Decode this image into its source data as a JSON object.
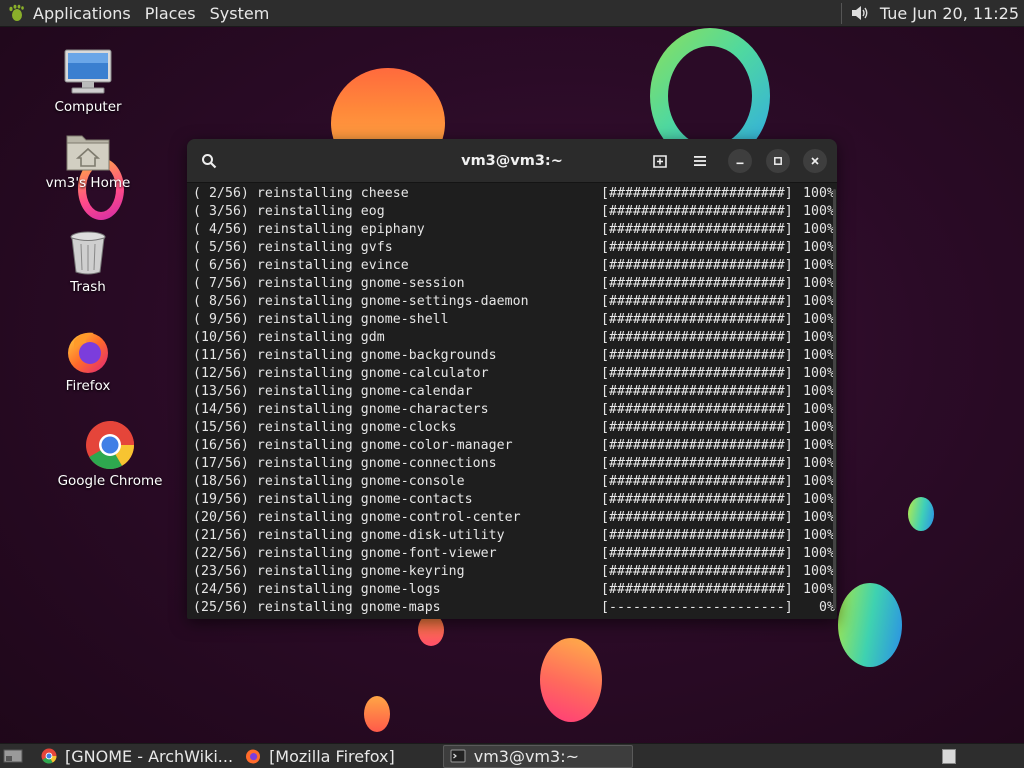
{
  "top_panel": {
    "menus": [
      "Applications",
      "Places",
      "System"
    ],
    "clock": "Tue Jun 20, 11:25",
    "icons": {
      "logo": "gnome-foot-icon",
      "volume": "volume-icon"
    }
  },
  "desktop": {
    "icons": [
      {
        "label": "Computer",
        "icon": "computer-icon"
      },
      {
        "label": "vm3's Home",
        "icon": "home-folder-icon"
      },
      {
        "label": "Trash",
        "icon": "trash-icon"
      },
      {
        "label": "Firefox",
        "icon": "firefox-icon"
      },
      {
        "label": "Google Chrome",
        "icon": "chrome-icon"
      }
    ]
  },
  "terminal": {
    "title": "vm3@vm3:~",
    "header_icons": [
      "search-icon",
      "new-tab-icon",
      "hamburger-menu-icon",
      "minimize-icon",
      "maximize-icon",
      "close-icon"
    ],
    "lines": [
      {
        "text": "( 2/56) reinstalling cheese",
        "bar": "[######################]",
        "pct": "100%"
      },
      {
        "text": "( 3/56) reinstalling eog",
        "bar": "[######################]",
        "pct": "100%"
      },
      {
        "text": "( 4/56) reinstalling epiphany",
        "bar": "[######################]",
        "pct": "100%"
      },
      {
        "text": "( 5/56) reinstalling gvfs",
        "bar": "[######################]",
        "pct": "100%"
      },
      {
        "text": "( 6/56) reinstalling evince",
        "bar": "[######################]",
        "pct": "100%"
      },
      {
        "text": "( 7/56) reinstalling gnome-session",
        "bar": "[######################]",
        "pct": "100%"
      },
      {
        "text": "( 8/56) reinstalling gnome-settings-daemon",
        "bar": "[######################]",
        "pct": "100%"
      },
      {
        "text": "( 9/56) reinstalling gnome-shell",
        "bar": "[######################]",
        "pct": "100%"
      },
      {
        "text": "(10/56) reinstalling gdm",
        "bar": "[######################]",
        "pct": "100%"
      },
      {
        "text": "(11/56) reinstalling gnome-backgrounds",
        "bar": "[######################]",
        "pct": "100%"
      },
      {
        "text": "(12/56) reinstalling gnome-calculator",
        "bar": "[######################]",
        "pct": "100%"
      },
      {
        "text": "(13/56) reinstalling gnome-calendar",
        "bar": "[######################]",
        "pct": "100%"
      },
      {
        "text": "(14/56) reinstalling gnome-characters",
        "bar": "[######################]",
        "pct": "100%"
      },
      {
        "text": "(15/56) reinstalling gnome-clocks",
        "bar": "[######################]",
        "pct": "100%"
      },
      {
        "text": "(16/56) reinstalling gnome-color-manager",
        "bar": "[######################]",
        "pct": "100%"
      },
      {
        "text": "(17/56) reinstalling gnome-connections",
        "bar": "[######################]",
        "pct": "100%"
      },
      {
        "text": "(18/56) reinstalling gnome-console",
        "bar": "[######################]",
        "pct": "100%"
      },
      {
        "text": "(19/56) reinstalling gnome-contacts",
        "bar": "[######################]",
        "pct": "100%"
      },
      {
        "text": "(20/56) reinstalling gnome-control-center",
        "bar": "[######################]",
        "pct": "100%"
      },
      {
        "text": "(21/56) reinstalling gnome-disk-utility",
        "bar": "[######################]",
        "pct": "100%"
      },
      {
        "text": "(22/56) reinstalling gnome-font-viewer",
        "bar": "[######################]",
        "pct": "100%"
      },
      {
        "text": "(23/56) reinstalling gnome-keyring",
        "bar": "[######################]",
        "pct": "100%"
      },
      {
        "text": "(24/56) reinstalling gnome-logs",
        "bar": "[######################]",
        "pct": "100%"
      },
      {
        "text": "(25/56) reinstalling gnome-maps",
        "bar": "[----------------------]",
        "pct": "0%"
      }
    ]
  },
  "taskbar": {
    "items": [
      {
        "label": "[GNOME - ArchWiki...",
        "icon": "chrome-icon",
        "active": false
      },
      {
        "label": "[Mozilla Firefox]",
        "icon": "firefox-icon",
        "active": false
      },
      {
        "label": "vm3@vm3:~",
        "icon": "terminal-icon",
        "active": true
      }
    ],
    "icons": {
      "show_desktop": "show-desktop-icon",
      "workspace": "workspace-switcher-icon"
    }
  },
  "colors": {
    "panel_bg": "#2d2d2d",
    "terminal_bg": "#1e1e1e",
    "terminal_header": "#2b2b2b",
    "wallpaper": "#2b0b27"
  }
}
